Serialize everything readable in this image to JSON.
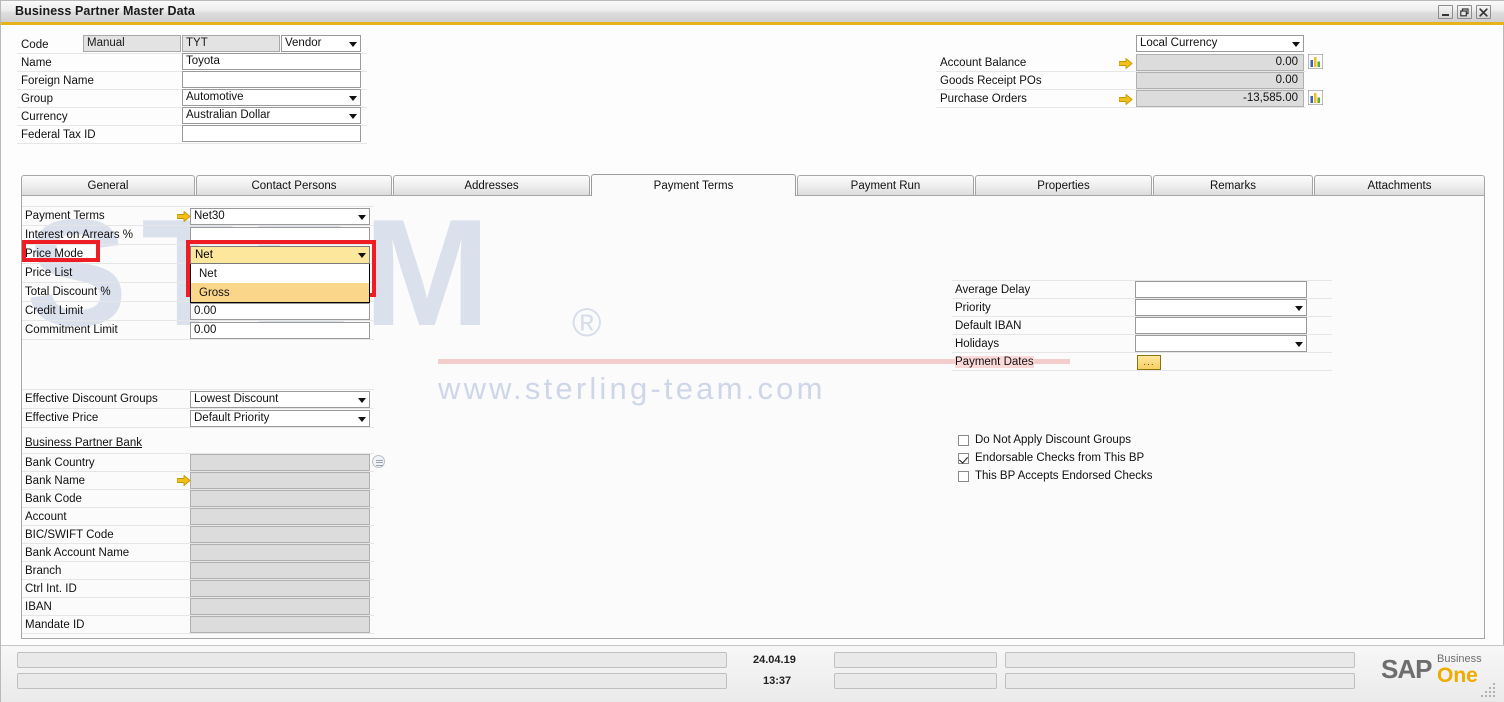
{
  "window": {
    "title": "Business Partner Master Data",
    "controls": [
      {
        "name": "minimize",
        "glyph": "_"
      },
      {
        "name": "restore",
        "glyph": "❐"
      },
      {
        "name": "close",
        "glyph": "✕"
      }
    ]
  },
  "header": {
    "fields": [
      {
        "label": "Code",
        "value": "Manual"
      },
      {
        "label": "Name",
        "value": "Toyota"
      },
      {
        "label": "Foreign Name",
        "value": ""
      },
      {
        "label": "Group",
        "value": "Automotive"
      },
      {
        "label": "Currency",
        "value": "Australian Dollar"
      },
      {
        "label": "Federal Tax ID",
        "value": ""
      }
    ],
    "code_value": "TYT",
    "bp_type": "Vendor",
    "currency_view": "Local Currency",
    "balances": [
      {
        "label": "Account Balance",
        "value": "0.00",
        "has_link": true,
        "has_chart": true
      },
      {
        "label": "Goods Receipt POs",
        "value": "0.00",
        "has_link": false,
        "has_chart": false
      },
      {
        "label": "Purchase Orders",
        "value": "-13,585.00",
        "has_link": true,
        "has_chart": true
      }
    ]
  },
  "tabs": [
    {
      "label": "General",
      "active": false,
      "accel": "n"
    },
    {
      "label": "Contact Persons",
      "active": false,
      "accel": "s"
    },
    {
      "label": "Addresses",
      "active": false,
      "accel": "A"
    },
    {
      "label": "Payment Terms",
      "active": true,
      "accel": ""
    },
    {
      "label": "Payment Run",
      "active": false,
      "accel": "P"
    },
    {
      "label": "Properties",
      "active": false,
      "accel": "t"
    },
    {
      "label": "Remarks",
      "active": false,
      "accel": "k"
    },
    {
      "label": "Attachments",
      "active": false,
      "accel": "c"
    }
  ],
  "payment_terms": {
    "left": [
      {
        "label": "Payment Terms",
        "value": "Net30",
        "type": "select",
        "link": true
      },
      {
        "label": "Interest on Arrears %",
        "value": "",
        "type": "text",
        "link": false
      },
      {
        "label": "Price Mode",
        "value": "Net",
        "type": "select",
        "link": false,
        "highlight": true
      },
      {
        "label": "Price List",
        "value": "",
        "type": "select",
        "link": false
      },
      {
        "label": "Total Discount %",
        "value": "",
        "type": "text",
        "link": false
      },
      {
        "label": "Credit Limit",
        "value": "0.00",
        "type": "text",
        "link": false
      },
      {
        "label": "Commitment Limit",
        "value": "0.00",
        "type": "text",
        "link": false
      }
    ],
    "price_mode_dropdown": {
      "selected": "Net",
      "options": [
        {
          "label": "Net",
          "highlighted": false
        },
        {
          "label": "Gross",
          "highlighted": true
        }
      ]
    },
    "effective": [
      {
        "label": "Effective Discount Groups",
        "value": "Lowest Discount"
      },
      {
        "label": "Effective Price",
        "value": "Default Priority"
      }
    ],
    "bank_section_title": "Business Partner Bank",
    "bank_fields": [
      {
        "label": "Bank Country",
        "value": "",
        "link": false,
        "list_icon": true
      },
      {
        "label": "Bank Name",
        "value": "",
        "link": true,
        "list_icon": false
      },
      {
        "label": "Bank Code",
        "value": "",
        "link": false,
        "list_icon": false
      },
      {
        "label": "Account",
        "value": "",
        "link": false,
        "list_icon": false
      },
      {
        "label": "BIC/SWIFT Code",
        "value": "",
        "link": false,
        "list_icon": false
      },
      {
        "label": "Bank Account Name",
        "value": "",
        "link": false,
        "list_icon": false
      },
      {
        "label": "Branch",
        "value": "",
        "link": false,
        "list_icon": false
      },
      {
        "label": "Ctrl Int. ID",
        "value": "",
        "link": false,
        "list_icon": false
      },
      {
        "label": "IBAN",
        "value": "",
        "link": false,
        "list_icon": false
      },
      {
        "label": "Mandate ID",
        "value": "",
        "link": false,
        "list_icon": false
      }
    ],
    "right_fields": [
      {
        "label": "Average Delay",
        "value": "",
        "type": "text"
      },
      {
        "label": "Priority",
        "value": "",
        "type": "select"
      },
      {
        "label": "Default IBAN",
        "value": "",
        "type": "text"
      },
      {
        "label": "Holidays",
        "value": "",
        "type": "select"
      },
      {
        "label": "Payment Dates",
        "value": "",
        "type": "button",
        "button_label": "..."
      }
    ],
    "checkboxes": [
      {
        "label": "Do Not Apply Discount Groups",
        "checked": false
      },
      {
        "label": "Endorsable Checks from This BP",
        "checked": true
      },
      {
        "label": "This BP Accepts Endorsed Checks",
        "checked": false
      }
    ]
  },
  "watermark": {
    "brand": "STEM",
    "registered": "®",
    "url": "www.sterling-team.com"
  },
  "statusbar": {
    "date": "24.04.19",
    "time": "13:37",
    "product_sap": "SAP",
    "product_business": "Business",
    "product_one": "One"
  },
  "colors": {
    "accent_yellow": "#e8b21c",
    "highlight_red": "#ee1c25",
    "dropdown_yellow": "#fde79c",
    "option_highlight": "#fad68a",
    "sap_orange": "#f0ab00"
  }
}
